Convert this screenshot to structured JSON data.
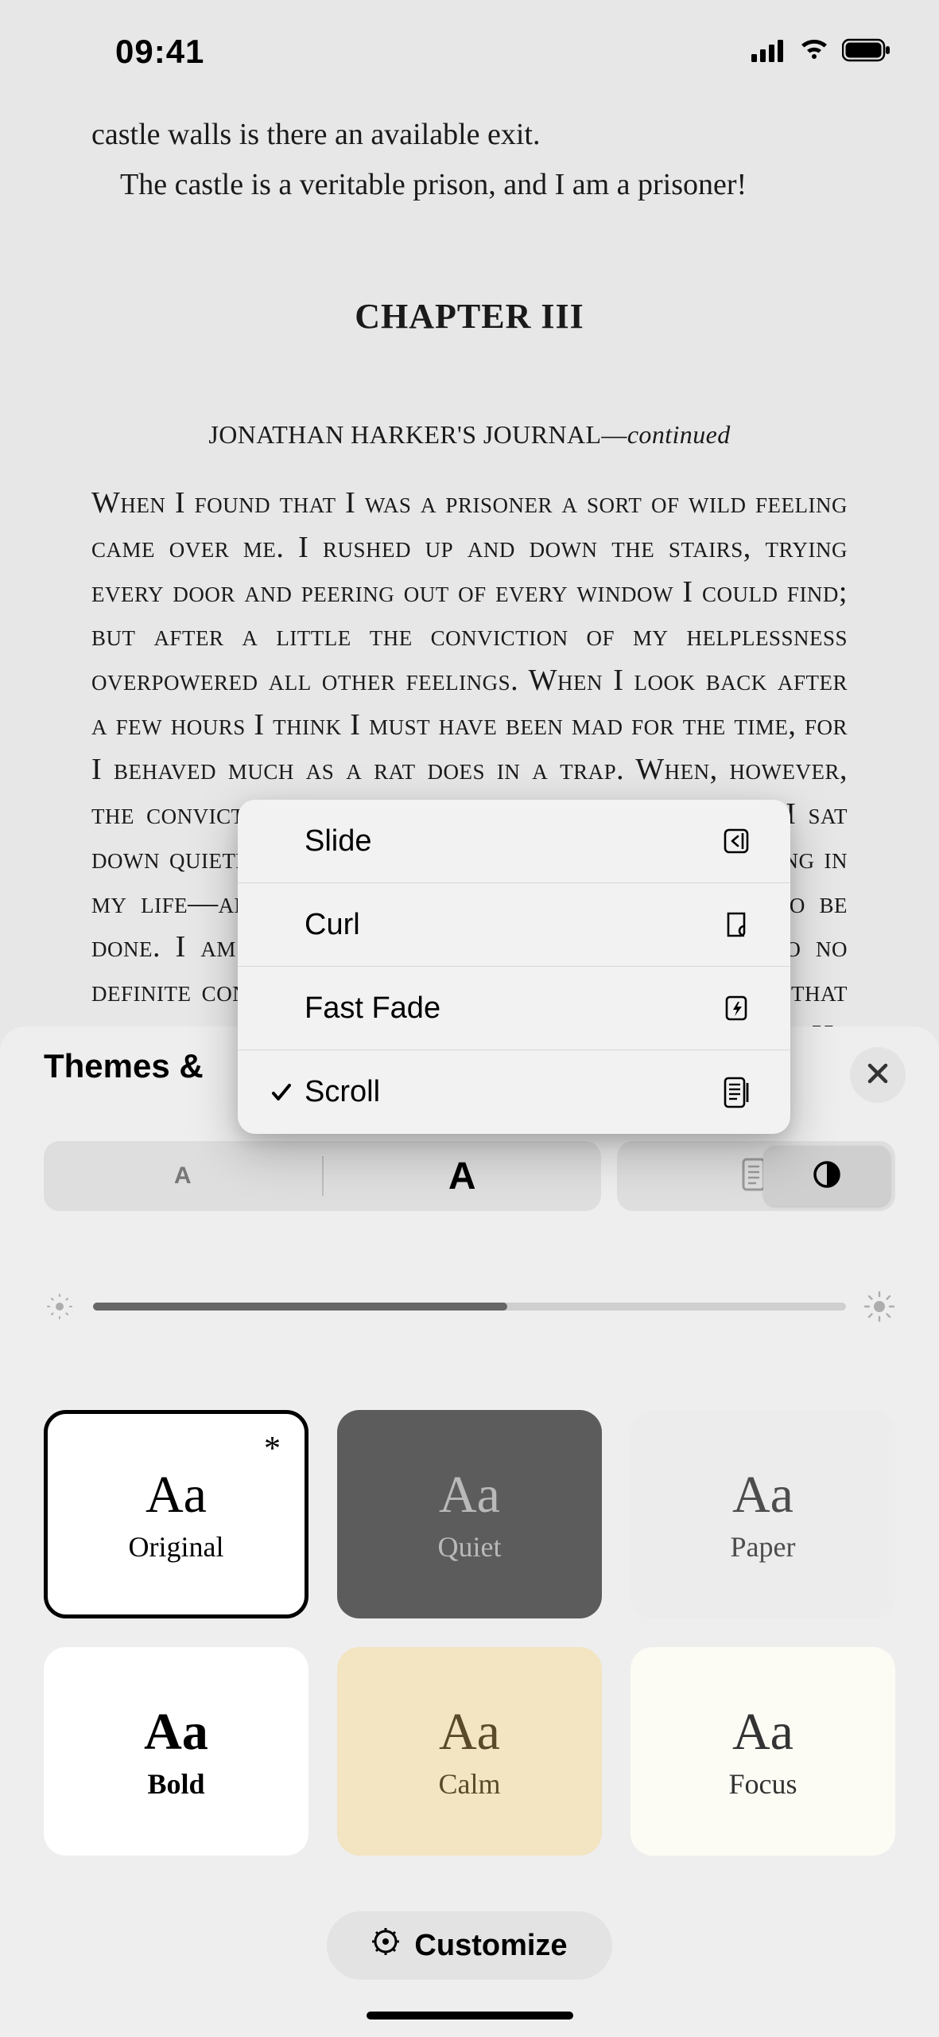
{
  "status": {
    "time": "09:41"
  },
  "reader": {
    "para1": "castle walls is there an available exit.",
    "para2": "The castle is a veritable prison, and I am a prisoner!",
    "chapter_title": "CHAPTER III",
    "journal_caps": "JONATHAN HARKER'S JOURNAL—",
    "journal_italic": "continued",
    "body": "When I found that I was a prisoner a sort of wild feeling came over me. I rushed up and down the stairs, trying every door and peering out of every window I could find; but after a little the conviction of my helplessness overpowered all other feelings. When I look back after a few hours I think I must have been mad for the time, for I behaved much as a rat does in a trap. When, however, the conviction had come to me that I was helpless I sat down quietly—as quietly as I have ever done anything in my life—and began to think over what was best to be done. I am thinking still, and as yet have come to no definite conclusion. Of one thing only am I certain; that it is no use making my ideas known to the Count. He knows well that I am imprisoned; and as he has done it himself, and has doubtless his own motives for it, he would only deceive me if I trusted him fully with the facts. So far"
  },
  "popup": {
    "items": [
      {
        "label": "Slide",
        "checked": false,
        "icon": "slide"
      },
      {
        "label": "Curl",
        "checked": false,
        "icon": "curl"
      },
      {
        "label": "Fast Fade",
        "checked": false,
        "icon": "fade"
      },
      {
        "label": "Scroll",
        "checked": true,
        "icon": "scroll"
      }
    ]
  },
  "sheet": {
    "title_visible": "Themes &",
    "font_small": "A",
    "font_large": "A",
    "brightness_percent": 55,
    "themes": [
      {
        "name": "Original",
        "aa": "Aa"
      },
      {
        "name": "Quiet",
        "aa": "Aa"
      },
      {
        "name": "Paper",
        "aa": "Aa"
      },
      {
        "name": "Bold",
        "aa": "Aa"
      },
      {
        "name": "Calm",
        "aa": "Aa"
      },
      {
        "name": "Focus",
        "aa": "Aa"
      }
    ],
    "customize_label": "Customize"
  }
}
